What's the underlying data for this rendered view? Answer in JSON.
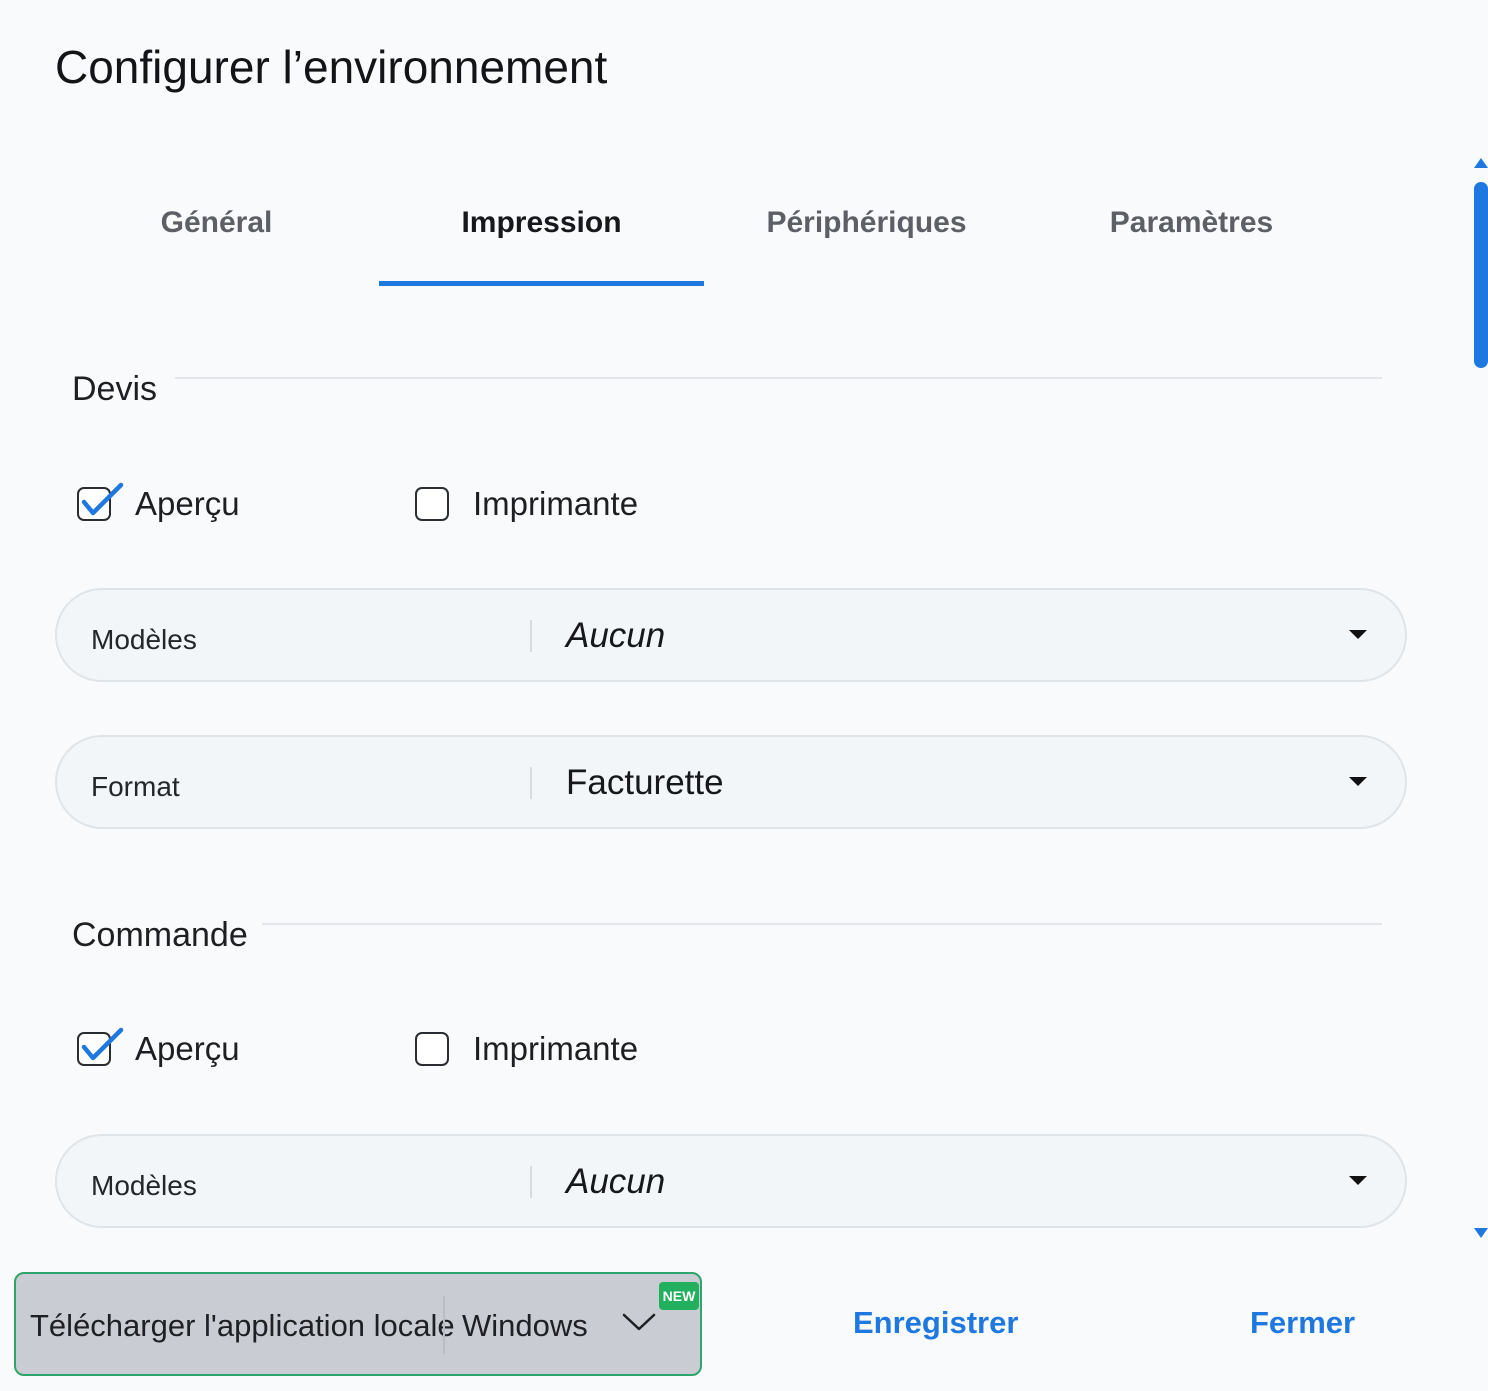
{
  "dialog": {
    "title": "Configurer l’environnement"
  },
  "tabs": [
    {
      "label": "Général",
      "active": false
    },
    {
      "label": "Impression",
      "active": true
    },
    {
      "label": "Périphériques",
      "active": false
    },
    {
      "label": "Paramètres",
      "active": false
    }
  ],
  "sections": {
    "devis": {
      "title": "Devis",
      "checkboxes": [
        {
          "label": "Aperçu",
          "checked": true
        },
        {
          "label": "Imprimante",
          "checked": false
        }
      ],
      "modeles": {
        "label": "Modèles",
        "value": "Aucun"
      },
      "format": {
        "label": "Format",
        "value": "Facturette"
      }
    },
    "commande": {
      "title": "Commande",
      "checkboxes": [
        {
          "label": "Aperçu",
          "checked": true
        },
        {
          "label": "Imprimante",
          "checked": false
        }
      ],
      "modeles": {
        "label": "Modèles",
        "value": "Aucun"
      }
    }
  },
  "footer": {
    "download_label": "Télécharger l'application locale",
    "download_os": "Windows",
    "new_badge": "NEW",
    "save_label": "Enregistrer",
    "close_label": "Fermer"
  },
  "colors": {
    "accent": "#1e78df",
    "badge": "#22b05f",
    "download_border": "#2fa56a"
  },
  "icons": [
    "check-icon",
    "caret-down-icon",
    "chevron-down-icon",
    "scroll-up-arrow-icon",
    "scroll-down-arrow-icon"
  ]
}
